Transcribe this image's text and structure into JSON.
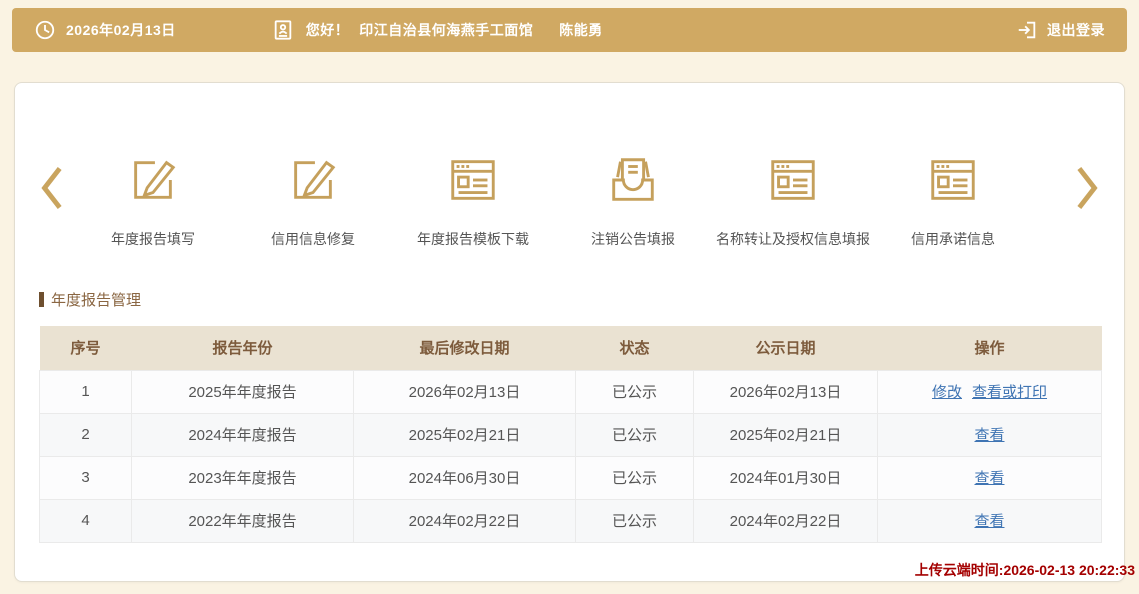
{
  "topbar": {
    "date": "2026年02月13日",
    "greeting": "您好！",
    "company": "印江自治县何海燕手工面馆",
    "user": "陈能勇",
    "logout_label": "退出登录"
  },
  "carousel": {
    "items": [
      {
        "label": "年度报告填写",
        "icon": "edit-icon"
      },
      {
        "label": "信用信息修复",
        "icon": "edit-icon"
      },
      {
        "label": "年度报告模板下载",
        "icon": "form-icon"
      },
      {
        "label": "注销公告填报",
        "icon": "inbox-icon"
      },
      {
        "label": "名称转让及授权信息填报",
        "icon": "form-icon"
      },
      {
        "label": "信用承诺信息",
        "icon": "form-icon"
      }
    ]
  },
  "section": {
    "title": "年度报告管理"
  },
  "table": {
    "headers": [
      "序号",
      "报告年份",
      "最后修改日期",
      "状态",
      "公示日期",
      "操作"
    ],
    "rows": [
      {
        "no": "1",
        "year": "2025年年度报告",
        "modified": "2026年02月13日",
        "status": "已公示",
        "publish": "2026年02月13日",
        "actions": [
          "修改",
          "查看或打印"
        ]
      },
      {
        "no": "2",
        "year": "2024年年度报告",
        "modified": "2025年02月21日",
        "status": "已公示",
        "publish": "2025年02月21日",
        "actions": [
          "查看"
        ]
      },
      {
        "no": "3",
        "year": "2023年年度报告",
        "modified": "2024年06月30日",
        "status": "已公示",
        "publish": "2024年01月30日",
        "actions": [
          "查看"
        ]
      },
      {
        "no": "4",
        "year": "2022年年度报告",
        "modified": "2024年02月22日",
        "status": "已公示",
        "publish": "2024年02月22日",
        "actions": [
          "查看"
        ]
      }
    ]
  },
  "footer": {
    "upload_time": "上传云端时间:2026-02-13 20:22:33"
  },
  "colors": {
    "brand_gold": "#d0a963",
    "icon_gold": "#c5a05c",
    "header_beige": "#eae2d2",
    "title_brown": "#8a6642",
    "link_blue": "#3f74b3",
    "timestamp_red": "#a40000",
    "page_cream": "#faf3e3"
  }
}
